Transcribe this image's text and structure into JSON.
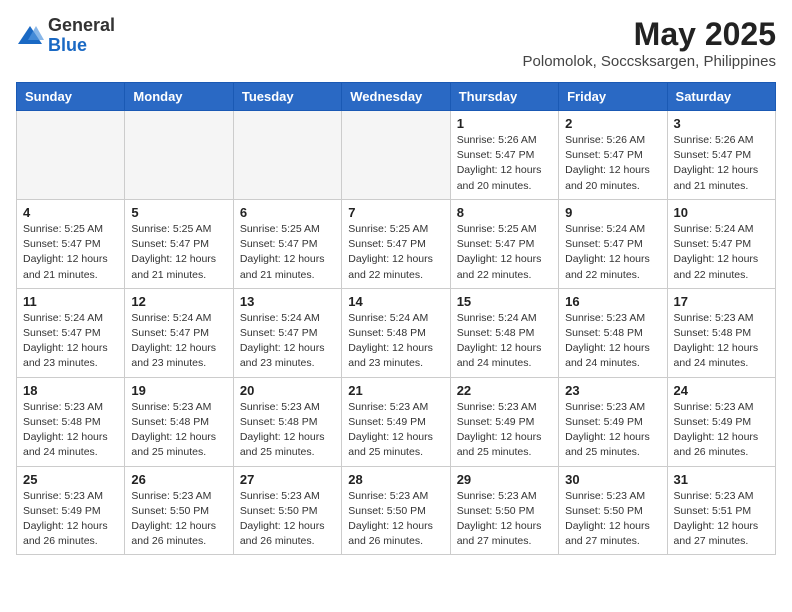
{
  "logo": {
    "general": "General",
    "blue": "Blue"
  },
  "title": "May 2025",
  "location": "Polomolok, Soccsksargen, Philippines",
  "days_of_week": [
    "Sunday",
    "Monday",
    "Tuesday",
    "Wednesday",
    "Thursday",
    "Friday",
    "Saturday"
  ],
  "weeks": [
    [
      {
        "day": "",
        "info": ""
      },
      {
        "day": "",
        "info": ""
      },
      {
        "day": "",
        "info": ""
      },
      {
        "day": "",
        "info": ""
      },
      {
        "day": "1",
        "info": "Sunrise: 5:26 AM\nSunset: 5:47 PM\nDaylight: 12 hours\nand 20 minutes."
      },
      {
        "day": "2",
        "info": "Sunrise: 5:26 AM\nSunset: 5:47 PM\nDaylight: 12 hours\nand 20 minutes."
      },
      {
        "day": "3",
        "info": "Sunrise: 5:26 AM\nSunset: 5:47 PM\nDaylight: 12 hours\nand 21 minutes."
      }
    ],
    [
      {
        "day": "4",
        "info": "Sunrise: 5:25 AM\nSunset: 5:47 PM\nDaylight: 12 hours\nand 21 minutes."
      },
      {
        "day": "5",
        "info": "Sunrise: 5:25 AM\nSunset: 5:47 PM\nDaylight: 12 hours\nand 21 minutes."
      },
      {
        "day": "6",
        "info": "Sunrise: 5:25 AM\nSunset: 5:47 PM\nDaylight: 12 hours\nand 21 minutes."
      },
      {
        "day": "7",
        "info": "Sunrise: 5:25 AM\nSunset: 5:47 PM\nDaylight: 12 hours\nand 22 minutes."
      },
      {
        "day": "8",
        "info": "Sunrise: 5:25 AM\nSunset: 5:47 PM\nDaylight: 12 hours\nand 22 minutes."
      },
      {
        "day": "9",
        "info": "Sunrise: 5:24 AM\nSunset: 5:47 PM\nDaylight: 12 hours\nand 22 minutes."
      },
      {
        "day": "10",
        "info": "Sunrise: 5:24 AM\nSunset: 5:47 PM\nDaylight: 12 hours\nand 22 minutes."
      }
    ],
    [
      {
        "day": "11",
        "info": "Sunrise: 5:24 AM\nSunset: 5:47 PM\nDaylight: 12 hours\nand 23 minutes."
      },
      {
        "day": "12",
        "info": "Sunrise: 5:24 AM\nSunset: 5:47 PM\nDaylight: 12 hours\nand 23 minutes."
      },
      {
        "day": "13",
        "info": "Sunrise: 5:24 AM\nSunset: 5:47 PM\nDaylight: 12 hours\nand 23 minutes."
      },
      {
        "day": "14",
        "info": "Sunrise: 5:24 AM\nSunset: 5:48 PM\nDaylight: 12 hours\nand 23 minutes."
      },
      {
        "day": "15",
        "info": "Sunrise: 5:24 AM\nSunset: 5:48 PM\nDaylight: 12 hours\nand 24 minutes."
      },
      {
        "day": "16",
        "info": "Sunrise: 5:23 AM\nSunset: 5:48 PM\nDaylight: 12 hours\nand 24 minutes."
      },
      {
        "day": "17",
        "info": "Sunrise: 5:23 AM\nSunset: 5:48 PM\nDaylight: 12 hours\nand 24 minutes."
      }
    ],
    [
      {
        "day": "18",
        "info": "Sunrise: 5:23 AM\nSunset: 5:48 PM\nDaylight: 12 hours\nand 24 minutes."
      },
      {
        "day": "19",
        "info": "Sunrise: 5:23 AM\nSunset: 5:48 PM\nDaylight: 12 hours\nand 25 minutes."
      },
      {
        "day": "20",
        "info": "Sunrise: 5:23 AM\nSunset: 5:48 PM\nDaylight: 12 hours\nand 25 minutes."
      },
      {
        "day": "21",
        "info": "Sunrise: 5:23 AM\nSunset: 5:49 PM\nDaylight: 12 hours\nand 25 minutes."
      },
      {
        "day": "22",
        "info": "Sunrise: 5:23 AM\nSunset: 5:49 PM\nDaylight: 12 hours\nand 25 minutes."
      },
      {
        "day": "23",
        "info": "Sunrise: 5:23 AM\nSunset: 5:49 PM\nDaylight: 12 hours\nand 25 minutes."
      },
      {
        "day": "24",
        "info": "Sunrise: 5:23 AM\nSunset: 5:49 PM\nDaylight: 12 hours\nand 26 minutes."
      }
    ],
    [
      {
        "day": "25",
        "info": "Sunrise: 5:23 AM\nSunset: 5:49 PM\nDaylight: 12 hours\nand 26 minutes."
      },
      {
        "day": "26",
        "info": "Sunrise: 5:23 AM\nSunset: 5:50 PM\nDaylight: 12 hours\nand 26 minutes."
      },
      {
        "day": "27",
        "info": "Sunrise: 5:23 AM\nSunset: 5:50 PM\nDaylight: 12 hours\nand 26 minutes."
      },
      {
        "day": "28",
        "info": "Sunrise: 5:23 AM\nSunset: 5:50 PM\nDaylight: 12 hours\nand 26 minutes."
      },
      {
        "day": "29",
        "info": "Sunrise: 5:23 AM\nSunset: 5:50 PM\nDaylight: 12 hours\nand 27 minutes."
      },
      {
        "day": "30",
        "info": "Sunrise: 5:23 AM\nSunset: 5:50 PM\nDaylight: 12 hours\nand 27 minutes."
      },
      {
        "day": "31",
        "info": "Sunrise: 5:23 AM\nSunset: 5:51 PM\nDaylight: 12 hours\nand 27 minutes."
      }
    ]
  ]
}
